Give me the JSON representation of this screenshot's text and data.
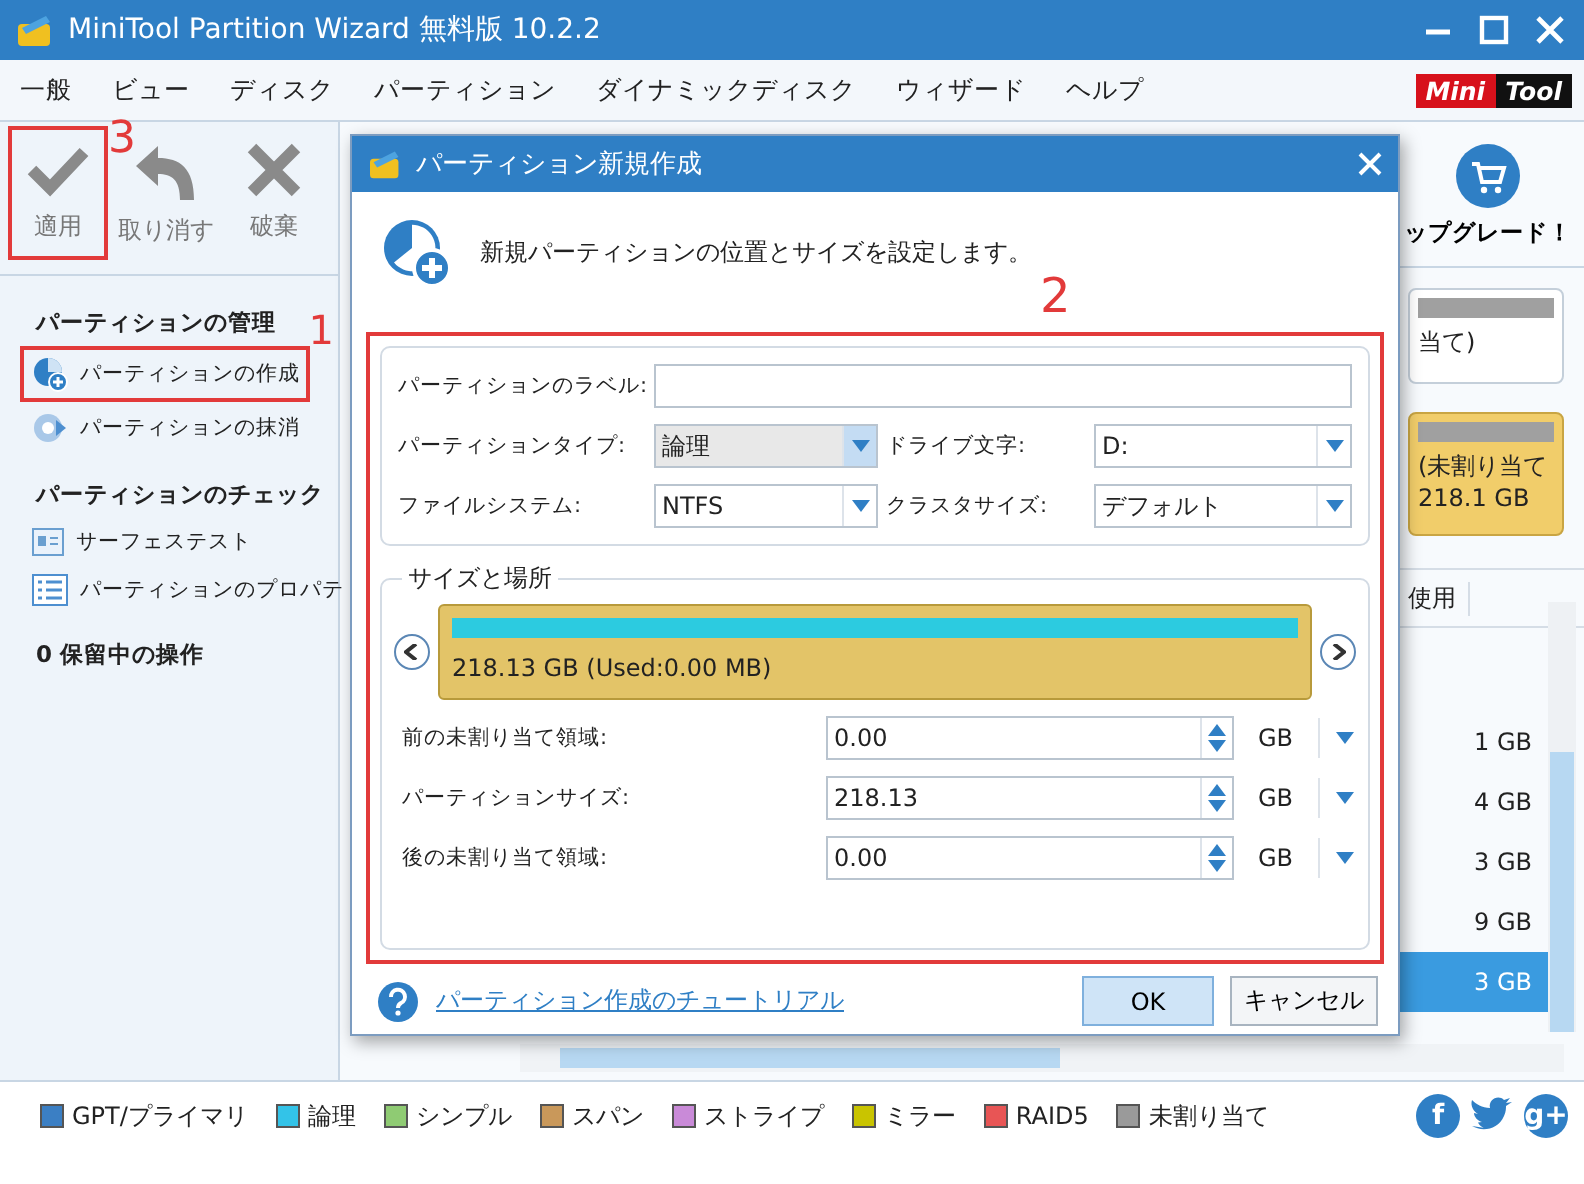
{
  "window": {
    "title": "MiniTool Partition Wizard 無料版 10.2.2"
  },
  "menu": [
    "一般",
    "ビュー",
    "ディスク",
    "パーティション",
    "ダイナミックディスク",
    "ウィザード",
    "ヘルプ"
  ],
  "logo": {
    "part_1": "Mini",
    "part_2": "Tool"
  },
  "toolbar": {
    "buttons": [
      {
        "kind": "apply",
        "label": "適用",
        "disabled": true,
        "annotation": "3"
      },
      {
        "kind": "undo",
        "label": "取り消す",
        "disabled": true
      },
      {
        "kind": "discard",
        "label": "破棄",
        "disabled": true
      }
    ],
    "upgrade": "ップグレード！"
  },
  "sidebar": {
    "sections": [
      {
        "title": "パーティションの管理",
        "items": [
          {
            "kind": "create",
            "label": "パーティションの作成",
            "annotation": "1"
          },
          {
            "kind": "wipe",
            "label": "パーティションの抹消"
          }
        ]
      },
      {
        "title": "パーティションのチェック",
        "items": [
          {
            "kind": "surface",
            "label": "サーフェステスト"
          },
          {
            "kind": "properties",
            "label": "パーティションのプロパテ"
          }
        ]
      },
      {
        "title": "0 保留中の操作"
      }
    ]
  },
  "disk_map": [
    {
      "kind": "partition",
      "lines": [
        "当て)"
      ]
    },
    {
      "kind": "unallocated",
      "lines": [
        "(未割り当て",
        "218.1 GB"
      ]
    }
  ],
  "table": {
    "columns": [
      "使用"
    ],
    "rows": [
      {
        "cells": [
          "1 GB"
        ],
        "selected": false
      },
      {
        "cells": [
          "4 GB"
        ],
        "selected": false
      },
      {
        "cells": [
          "3 GB"
        ],
        "selected": false
      },
      {
        "cells": [
          "9 GB"
        ],
        "selected": false
      },
      {
        "cells": [
          "3 GB"
        ],
        "selected": true
      }
    ]
  },
  "dialog": {
    "title": "パーティション新規作成",
    "intro": "新規パーティションの位置とサイズを設定します。",
    "annotation": "2",
    "label_field": {
      "label": "パーティションのラベル:"
    },
    "fields": [
      {
        "label": "パーティションタイプ:",
        "value": "論理",
        "focused": true
      },
      {
        "label": "ドライブ文字:",
        "value": "D:",
        "focused": false
      },
      {
        "label": "ファイルシステム:",
        "value": "NTFS",
        "focused": false
      },
      {
        "label": "クラスタサイズ:",
        "value": "デフォルト",
        "focused": false
      }
    ],
    "size_group": {
      "title": "サイズと場所",
      "bar_text": "218.13 GB (Used:0.00 MB)",
      "rows": [
        {
          "label": "前の未割り当て領域:",
          "value": "0.00",
          "unit": "GB"
        },
        {
          "label": "パーティションサイズ:",
          "value": "218.13",
          "unit": "GB"
        },
        {
          "label": "後の未割り当て領域:",
          "value": "0.00",
          "unit": "GB"
        }
      ]
    },
    "help_link": "パーティション作成のチュートリアル",
    "buttons": [
      {
        "label": "OK",
        "default": true
      },
      {
        "label": "キャンセル",
        "default": false
      }
    ]
  },
  "legend": [
    {
      "label": "GPT/プライマリ",
      "color": "#3b7fc4"
    },
    {
      "label": "論理",
      "color": "#33c3e8"
    },
    {
      "label": "シンプル",
      "color": "#8fcb73"
    },
    {
      "label": "スパン",
      "color": "#c9985a"
    },
    {
      "label": "ストライプ",
      "color": "#c98ad8"
    },
    {
      "label": "ミラー",
      "color": "#c9c400"
    },
    {
      "label": "RAID5",
      "color": "#e85555"
    },
    {
      "label": "未割り当て",
      "color": "#9a9a9a"
    }
  ],
  "social": [
    {
      "kind": "facebook",
      "glyph": "f"
    },
    {
      "kind": "twitter"
    },
    {
      "kind": "googleplus",
      "glyph": "g+"
    }
  ]
}
